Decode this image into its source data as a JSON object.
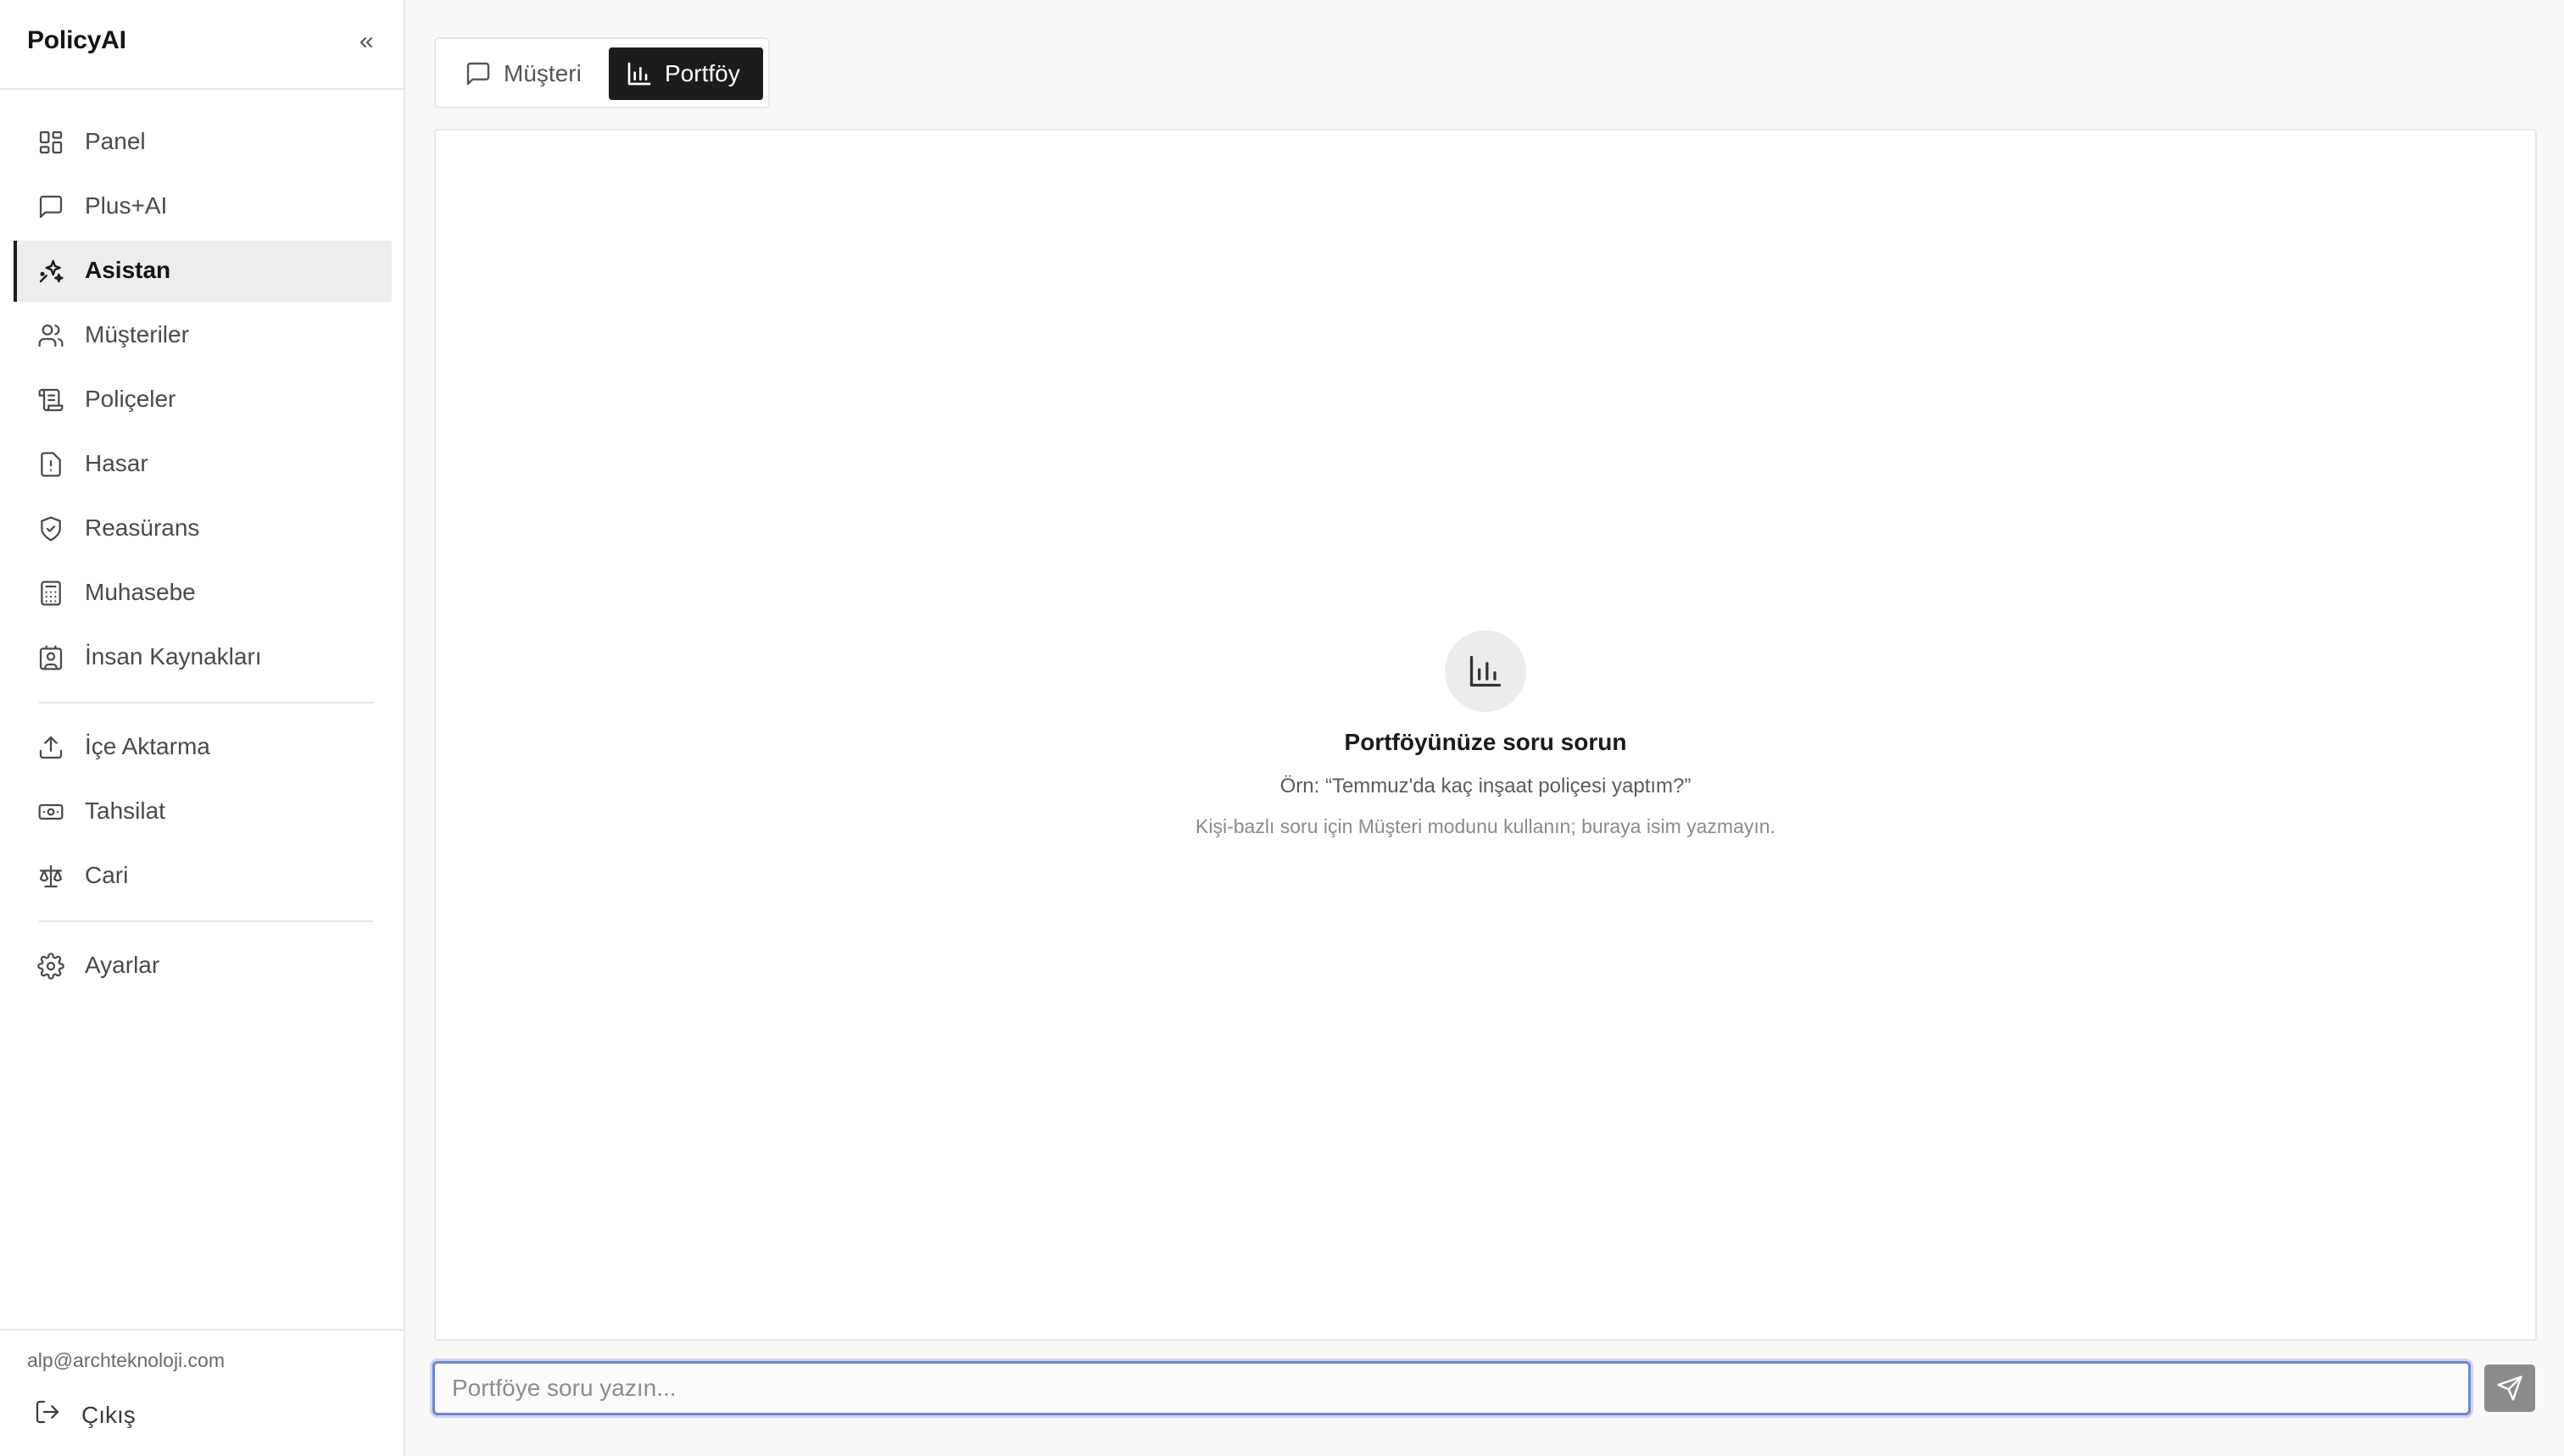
{
  "app": {
    "brand": "PolicyAI"
  },
  "sidebar": {
    "collapse_icon": "chevrons-left-icon",
    "items": [
      {
        "label": "Panel",
        "icon": "layout-grid-icon",
        "active": false
      },
      {
        "label": "Plus+AI",
        "icon": "message-square-icon",
        "active": false
      },
      {
        "label": "Asistan",
        "icon": "sparkles-icon",
        "active": true
      },
      {
        "label": "Müşteriler",
        "icon": "users-icon",
        "active": false
      },
      {
        "label": "Poliçeler",
        "icon": "scroll-icon",
        "active": false
      },
      {
        "label": "Hasar",
        "icon": "file-alert-icon",
        "active": false
      },
      {
        "label": "Reasürans",
        "icon": "shield-check-icon",
        "active": false
      },
      {
        "label": "Muhasebe",
        "icon": "calculator-icon",
        "active": false
      },
      {
        "label": "İnsan Kaynakları",
        "icon": "contact-icon",
        "active": false
      }
    ],
    "tools": [
      {
        "label": "İçe Aktarma",
        "icon": "upload-icon"
      },
      {
        "label": "Tahsilat",
        "icon": "banknote-icon"
      },
      {
        "label": "Cari",
        "icon": "scale-icon"
      }
    ],
    "settings": {
      "label": "Ayarlar",
      "icon": "gear-icon"
    },
    "footer": {
      "email": "alp@archteknoloji.com",
      "logout_label": "Çıkış",
      "logout_icon": "log-out-icon"
    }
  },
  "mode_switch": {
    "options": [
      {
        "label": "Müşteri",
        "icon": "message-square-icon",
        "selected": false
      },
      {
        "label": "Portföy",
        "icon": "bar-chart-icon",
        "selected": true
      }
    ]
  },
  "empty_state": {
    "icon": "bar-chart-icon",
    "title": "Portföyünüze soru sorun",
    "example": "Örn: “Temmuz'da kaç inşaat poliçesi yaptım?”",
    "hint": "Kişi-bazlı soru için Müşteri modunu kullanın; buraya isim yazmayın."
  },
  "composer": {
    "placeholder": "Portföye soru yazın...",
    "value": "",
    "send_icon": "send-icon"
  }
}
